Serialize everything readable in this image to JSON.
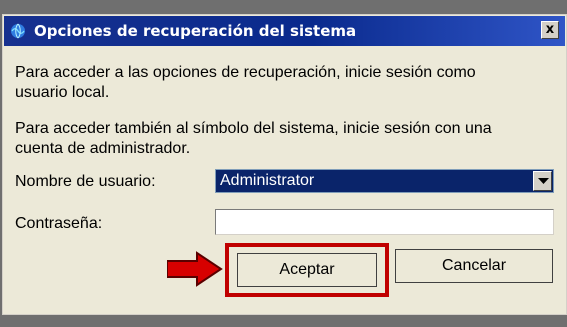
{
  "window": {
    "title": "Opciones de recuperación del sistema",
    "close_label": "x"
  },
  "dialog": {
    "text_line_1": "Para acceder a las opciones de recuperación, inicie sesión como",
    "text_line_2": "usuario local.",
    "text_line_3": "Para acceder también al símbolo del sistema, inicie sesión con una",
    "text_line_4": "cuenta de administrador.",
    "username_label": "Nombre de usuario:",
    "username_value": "Administrator",
    "password_label": "Contraseña:",
    "password_value": ""
  },
  "buttons": {
    "accept_label": "Aceptar",
    "cancel_label": "Cancelar"
  },
  "icons": {
    "title_icon": "globe-icon",
    "dropdown_icon": "chevron-down-icon",
    "pointer_icon": "arrow-right-icon"
  },
  "colors": {
    "titlebar_blue": "#0a2a8d",
    "selection_blue": "#0a246a",
    "highlight_red": "#c00000"
  }
}
